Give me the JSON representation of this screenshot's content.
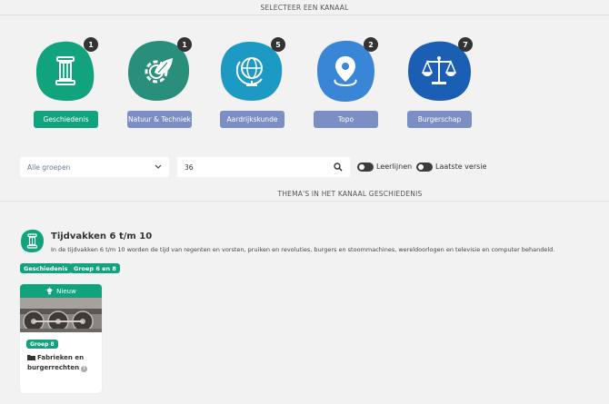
{
  "header": {
    "select_channel": "SELECTEER EEN KANAAL"
  },
  "channels": [
    {
      "label": "Geschiedenis",
      "count": "1",
      "color": "#11a37e",
      "button_color": "#11a37e",
      "icon": "column-icon"
    },
    {
      "label": "Natuur & Techniek",
      "count": "1",
      "color": "#2a8f7a",
      "button_color": "#7b8fc4",
      "icon": "gear-leaf-icon"
    },
    {
      "label": "Aardrijkskunde",
      "count": "5",
      "color": "#1d9ac4",
      "button_color": "#7b8fc4",
      "icon": "globe-icon"
    },
    {
      "label": "Topo",
      "count": "2",
      "color": "#3a86d6",
      "button_color": "#7b8fc4",
      "icon": "location-pin-icon"
    },
    {
      "label": "Burgerschap",
      "count": "7",
      "color": "#1a5fb4",
      "button_color": "#7b8fc4",
      "icon": "scales-icon"
    }
  ],
  "filters": {
    "group_select": "Alle groepen",
    "search_value": "36",
    "toggle_leerlijnen": "Leerlijnen",
    "toggle_latest": "Laatste versie"
  },
  "themes_heading": "THEMA'S IN HET KANAAL GESCHIEDENIS",
  "theme": {
    "title": "Tijdvakken 6 t/m 10",
    "description": "In de tijdvakken 6 t/m 10 worden de tijd van regenten en vorsten, pruiken en revoluties, burgers en stoommachines, wereldoorlogen en televisie en computer behandeld.",
    "tags": [
      "Geschiedenis",
      "Groep 6 en 8"
    ]
  },
  "card": {
    "badge": "Nieuw",
    "group": "Groep 8",
    "title": "Fabrieken en burgerrechten",
    "info": "i"
  }
}
